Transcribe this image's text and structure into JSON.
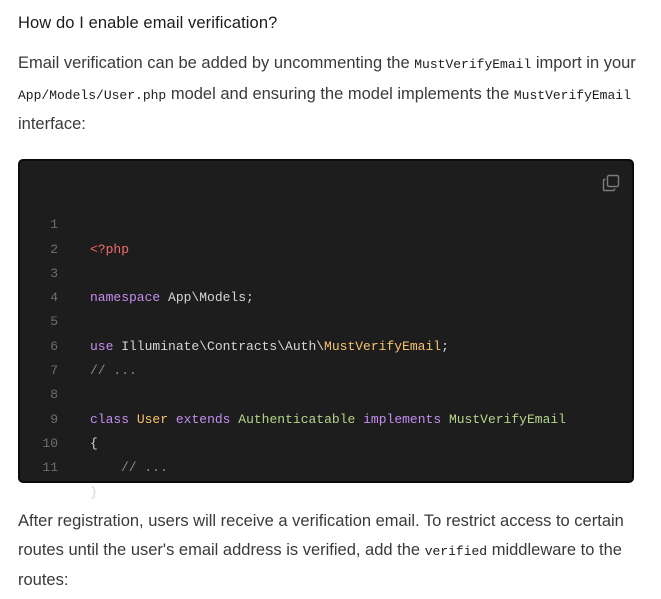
{
  "heading": "How do I enable email verification?",
  "para1": {
    "t1": "Email verification can be added by uncommenting the ",
    "c1": "MustVerifyEmail",
    "t2": " import in your ",
    "c2": "App/Models/User.php",
    "t3": " model and ensuring the model implements the ",
    "c3": "MustVerifyEmail",
    "t4": " interface:"
  },
  "code": {
    "copy_icon": "copy-icon",
    "line_numbers": [
      "1",
      "2",
      "3",
      "4",
      "5",
      "6",
      "7",
      "8",
      "9",
      "10",
      "11"
    ],
    "l1": {
      "tag": "<?php"
    },
    "l3": {
      "kw": "namespace",
      "rest": " App\\Models;"
    },
    "l5": {
      "kw": "use",
      "path": " Illuminate\\Contracts\\Auth\\",
      "cls": "MustVerifyEmail",
      "semi": ";"
    },
    "l6": {
      "cmt": "// ..."
    },
    "l8": {
      "kw1": "class",
      "cls": "User",
      "kw2": "extends",
      "t1": "Authenticatable",
      "kw3": "implements",
      "t2": "MustVerifyEmail"
    },
    "l9": {
      "brace": "{"
    },
    "l10": {
      "cmt": "// ..."
    },
    "l11": {
      "brace": "}"
    },
    "colors": {
      "background": "#1d1d1d",
      "keyword": "#c48df0",
      "php_tag": "#f2686b",
      "class_name": "#f7c36b",
      "type": "#b5d58a",
      "comment": "#8a8a8a",
      "plain": "#d6d6d6"
    }
  },
  "para2": {
    "t1": "After registration, users will receive a verification email. To restrict access to certain routes until the user's email address is verified, add the ",
    "c1": "verified",
    "t2": " middleware to the routes:"
  }
}
